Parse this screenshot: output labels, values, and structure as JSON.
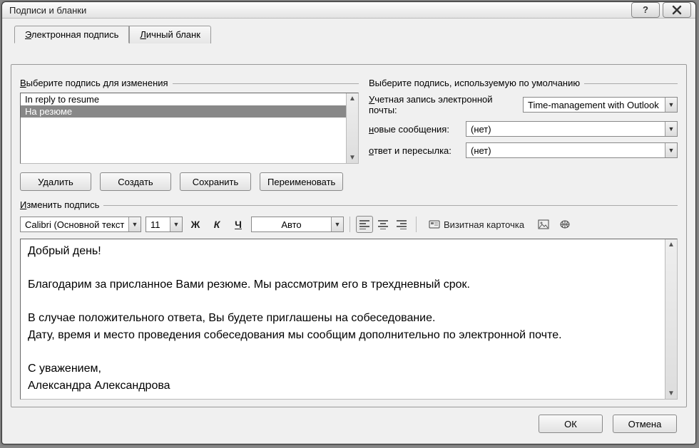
{
  "window": {
    "title": "Подписи и бланки"
  },
  "tabs": {
    "t1": "Электронная подпись",
    "t2": "Личный бланк"
  },
  "groupSelect": {
    "legend": "Выберите подпись для изменения",
    "items": [
      "In reply to resume",
      "На резюме"
    ],
    "selectedIndex": 1,
    "buttons": {
      "delete": "Удалить",
      "new": "Создать",
      "save": "Сохранить",
      "rename": "Переименовать"
    }
  },
  "groupDefault": {
    "legend": "Выберите подпись, используемую по умолчанию",
    "accountLabel": "Учетная запись электронной почты:",
    "accountValue": "Time-management with Outlook",
    "newLabel": "новые сообщения:",
    "newValue": "(нет)",
    "replyLabel": "ответ и пересылка:",
    "replyValue": "(нет)"
  },
  "editSection": {
    "legend": "Изменить подпись",
    "font": "Calibri (Основной текст",
    "size": "11",
    "bold": "Ж",
    "italic": "К",
    "underline": "Ч",
    "color": "Авто",
    "bizcard": "Визитная карточка",
    "body": {
      "l1": "Добрый день!",
      "l2": "Благодарим за присланное Вами резюме. Мы рассмотрим его в трехдневный срок.",
      "l3": "В случае положительного ответа, Вы будете приглашены на собеседование.",
      "l4": "Дату, время и место проведения собеседования мы сообщим дополнительно по электронной почте.",
      "l5": "С уважением,",
      "l6": "Александра Александрова"
    }
  },
  "footer": {
    "ok": "ОК",
    "cancel": "Отмена"
  }
}
